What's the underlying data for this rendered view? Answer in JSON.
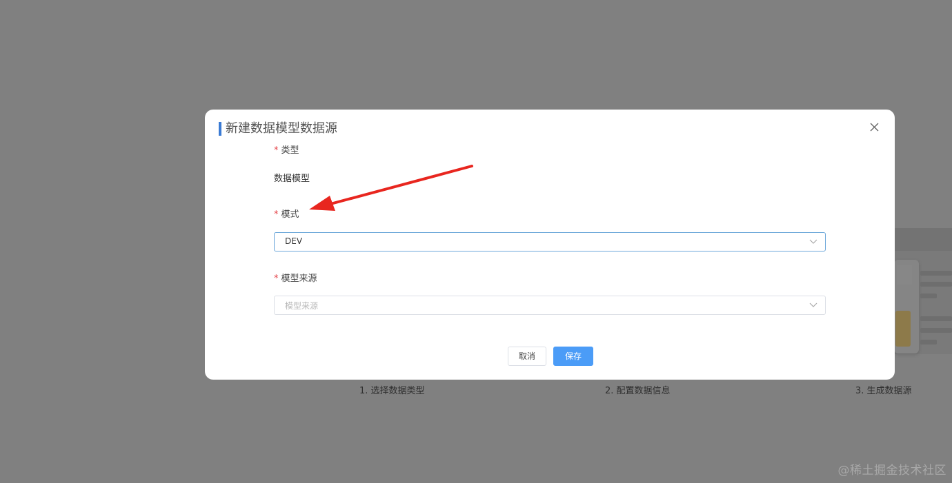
{
  "modal": {
    "title": "新建数据模型数据源",
    "fields": {
      "type": {
        "required_mark": "*",
        "label": "类型",
        "value": "数据模型"
      },
      "mode": {
        "required_mark": "*",
        "label": "模式",
        "value": "DEV"
      },
      "model_source": {
        "required_mark": "*",
        "label": "模型来源",
        "placeholder": "模型来源"
      }
    },
    "buttons": {
      "cancel": "取消",
      "save": "保存"
    }
  },
  "background": {
    "steps": [
      "1. 选择数据类型",
      "2. 配置数据信息",
      "3. 生成数据源"
    ]
  },
  "watermark": "@稀土掘金技术社区",
  "colors": {
    "mask": "#808080",
    "title_accent": "#3b7bd4",
    "primary": "#4b9cf7",
    "required": "#e5484d",
    "annotation_arrow": "#e8261f"
  },
  "icons": {
    "close": "close-icon",
    "dropdown": "chevron-down-icon",
    "annotation": "red-arrow"
  }
}
